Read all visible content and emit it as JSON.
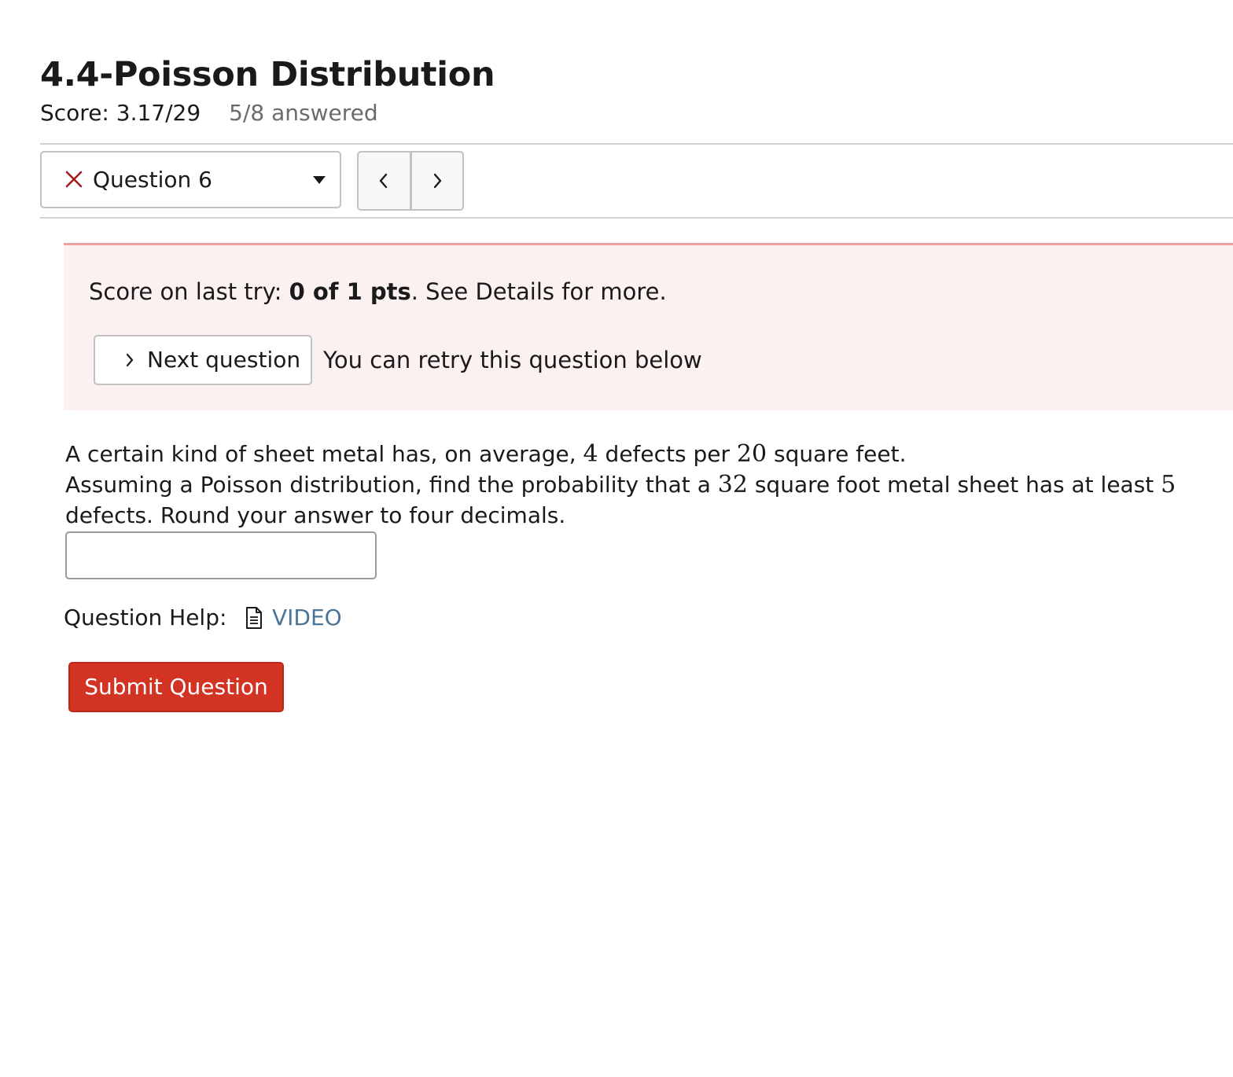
{
  "header": {
    "title": "4.4-Poisson Distribution",
    "score": "Score: 3.17/29",
    "answered": "5/8 answered"
  },
  "question_selector": {
    "status_icon": "x-icon",
    "label": "Question 6"
  },
  "navigation": {
    "prev_icon": "chevron-left-icon",
    "next_icon": "chevron-right-icon"
  },
  "alert": {
    "prefix": "Score on last try: ",
    "score_bold": "0 of 1 pts",
    "suffix": ". See Details for more.",
    "next_button_label": "Next question",
    "retry_text": "You can retry this question below"
  },
  "question": {
    "text_1": "A certain kind of sheet metal has, on average, ",
    "num_1": "4",
    "text_2": " defects per ",
    "num_2": "20",
    "text_3": " square feet.",
    "text_4": "Assuming a Poisson distribution, find the probability that a ",
    "num_3": "32",
    "text_5": " square foot metal sheet has at least ",
    "num_4": "5",
    "text_6": "defects. Round your answer to four decimals.",
    "answer_value": ""
  },
  "help": {
    "label": "Question Help:",
    "icon": "document-icon",
    "video_label": "VIDEO"
  },
  "submit": {
    "label": "Submit Question"
  },
  "colors": {
    "error_x": "#a61b1b",
    "alert_bg": "#fcf1f1",
    "alert_border": "#efa0a0",
    "link": "#4a7599",
    "submit_bg": "#d23322"
  }
}
